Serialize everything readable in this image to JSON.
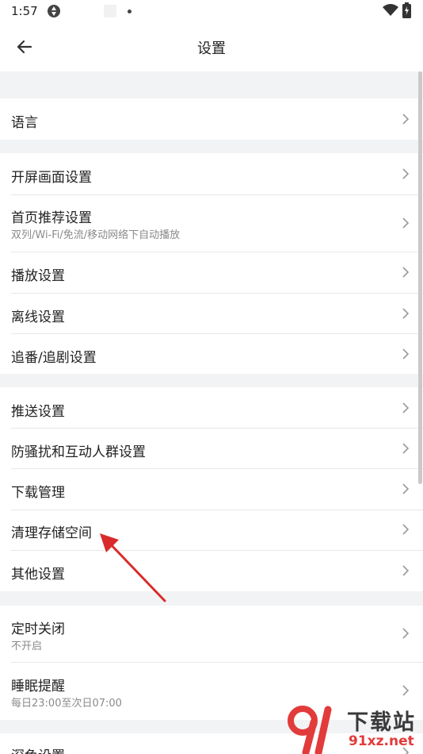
{
  "status_bar": {
    "time": "1:57",
    "icons": [
      "sync-icon",
      "notification-square-icon",
      "dot-icon",
      "wifi-icon",
      "battery-icon"
    ]
  },
  "header": {
    "title": "设置"
  },
  "groups": [
    {
      "rows": [
        {
          "label": "语言"
        }
      ]
    },
    {
      "rows": [
        {
          "label": "开屏画面设置"
        },
        {
          "label": "首页推荐设置",
          "sub": "双列/Wi-Fi/免流/移动网络下自动播放"
        },
        {
          "label": "播放设置"
        },
        {
          "label": "离线设置"
        },
        {
          "label": "追番/追剧设置"
        }
      ]
    },
    {
      "rows": [
        {
          "label": "推送设置"
        },
        {
          "label": "防骚扰和互动人群设置"
        },
        {
          "label": "下载管理"
        },
        {
          "label": "清理存储空间"
        },
        {
          "label": "其他设置"
        }
      ]
    },
    {
      "rows": [
        {
          "label": "定时关闭",
          "sub": "不开启"
        },
        {
          "label": "睡眠提醒",
          "sub": "每日23:00至次日07:00"
        }
      ]
    },
    {
      "rows": [
        {
          "label": "深色设置"
        }
      ]
    }
  ],
  "annotation": {
    "color": "#d92b2b",
    "icon": "red-arrow-annotation"
  },
  "watermark": {
    "brand": "下载站",
    "url": "91xz.net",
    "logo": "91-logo-mark"
  }
}
